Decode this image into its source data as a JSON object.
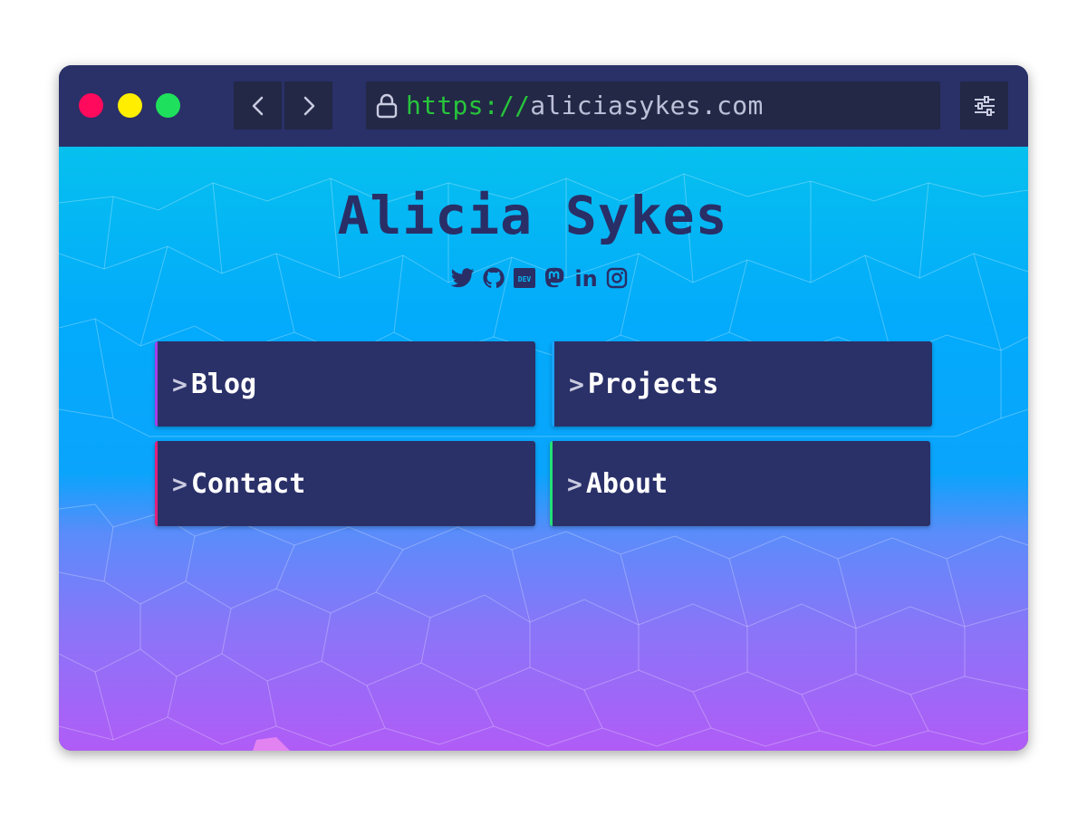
{
  "browser": {
    "url_scheme": "https://",
    "url_host": "aliciasykes.com",
    "back_icon": "chevron-left-icon",
    "forward_icon": "chevron-right-icon",
    "lock_icon": "lock-icon",
    "settings_icon": "sliders-icon",
    "traffic_lights": [
      "#ff0a5c",
      "#ffee00",
      "#1fe05c"
    ]
  },
  "page": {
    "title": "Alicia Sykes",
    "socials": [
      {
        "icon": "twitter-icon"
      },
      {
        "icon": "github-icon"
      },
      {
        "icon": "dev-icon",
        "text": "DEV"
      },
      {
        "icon": "mastodon-icon"
      },
      {
        "icon": "linkedin-icon",
        "text": "in"
      },
      {
        "icon": "instagram-icon"
      }
    ],
    "nav": [
      {
        "chevron": ">",
        "label": "Blog",
        "accent": "#a53ee8"
      },
      {
        "chevron": ">",
        "label": "Projects",
        "accent": "#1aa3ff"
      },
      {
        "chevron": ">",
        "label": "Contact",
        "accent": "#e0207a"
      },
      {
        "chevron": ">",
        "label": "About",
        "accent": "#22e07a"
      }
    ]
  },
  "colors": {
    "frame": "#2a3068",
    "control_bg": "#222845",
    "title_text": "#2a2e66",
    "bg_top": "#06c0ee",
    "bg_bottom": "#b05cf6"
  }
}
